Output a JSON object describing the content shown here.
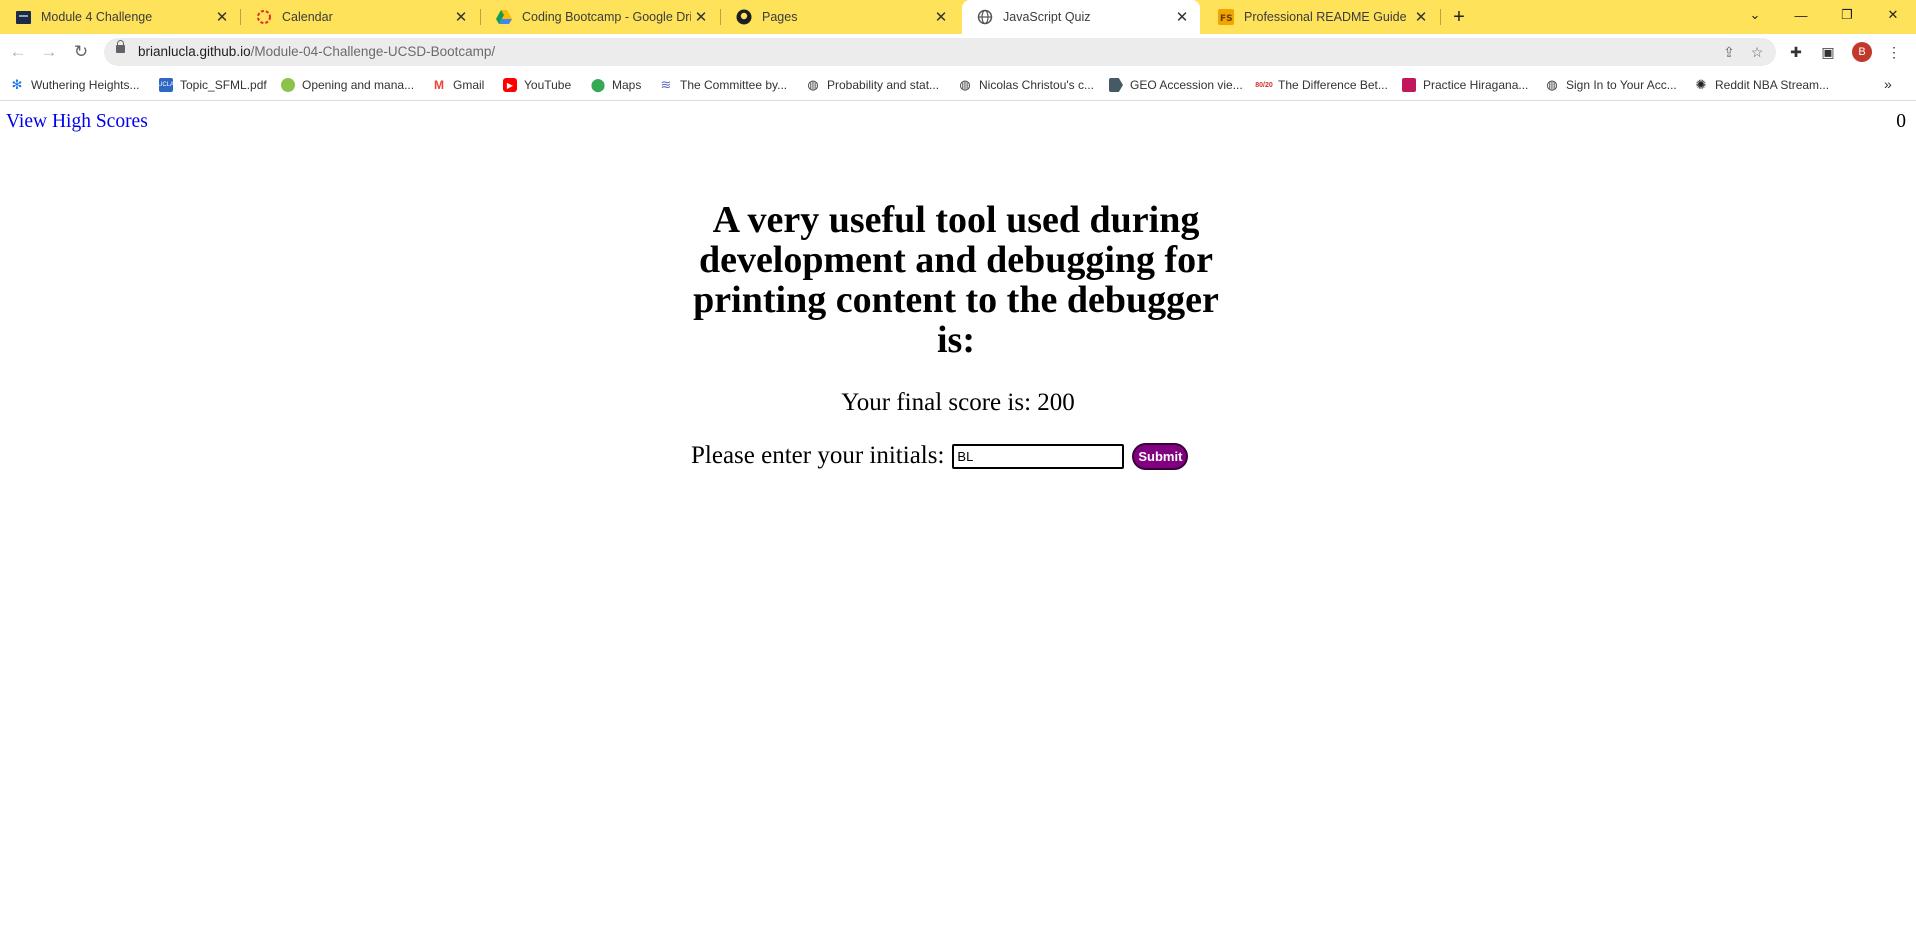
{
  "browser": {
    "tabs": [
      {
        "title": "Module 4 Challenge",
        "icon": "course-site-icon",
        "active": false
      },
      {
        "title": "Calendar",
        "icon": "calendar-icon",
        "active": false
      },
      {
        "title": "Coding Bootcamp - Google Drive",
        "icon": "google-drive-icon",
        "active": false
      },
      {
        "title": "Pages",
        "icon": "github-icon",
        "active": false
      },
      {
        "title": "JavaScript Quiz",
        "icon": "globe-icon",
        "active": true
      },
      {
        "title": "Professional README Guide | The",
        "icon": "readme-guide-icon",
        "active": false
      }
    ],
    "url": {
      "host": "brianlucla.github.io",
      "path": "/Module-04-Challenge-UCSD-Bootcamp/"
    },
    "profile_initial": "B",
    "bookmarks": [
      {
        "label": "Wuthering Heights...",
        "icon": "snowflake-icon"
      },
      {
        "label": "Topic_SFML.pdf",
        "icon": "ucla-icon"
      },
      {
        "label": "Opening and mana...",
        "icon": "leaf-icon"
      },
      {
        "label": "Gmail",
        "icon": "gmail-icon"
      },
      {
        "label": "YouTube",
        "icon": "youtube-icon"
      },
      {
        "label": "Maps",
        "icon": "maps-icon"
      },
      {
        "label": "The Committee by...",
        "icon": "layers-icon"
      },
      {
        "label": "Probability and stat...",
        "icon": "globe-icon"
      },
      {
        "label": "Nicolas Christou's c...",
        "icon": "globe-icon"
      },
      {
        "label": "GEO Accession vie...",
        "icon": "geo-icon"
      },
      {
        "label": "The Difference Bet...",
        "icon": "80-20-icon"
      },
      {
        "label": "Practice Hiragana...",
        "icon": "hiragana-icon"
      },
      {
        "label": "Sign In to Your Acc...",
        "icon": "globe-icon"
      },
      {
        "label": "Reddit NBA Stream...",
        "icon": "basketball-icon"
      }
    ]
  },
  "page": {
    "view_high_scores": "View High Scores",
    "timer": "0",
    "question": "A very useful tool used during development and debugging for printing content to the debugger is:",
    "final_score": "Your final score is: 200",
    "initials_label": "Please enter your initials:",
    "initials_value": "BL",
    "submit_label": "Submit"
  },
  "colors": {
    "tab_strip": "#fde25a",
    "link": "#0000ee",
    "submit_bg": "#800080"
  }
}
